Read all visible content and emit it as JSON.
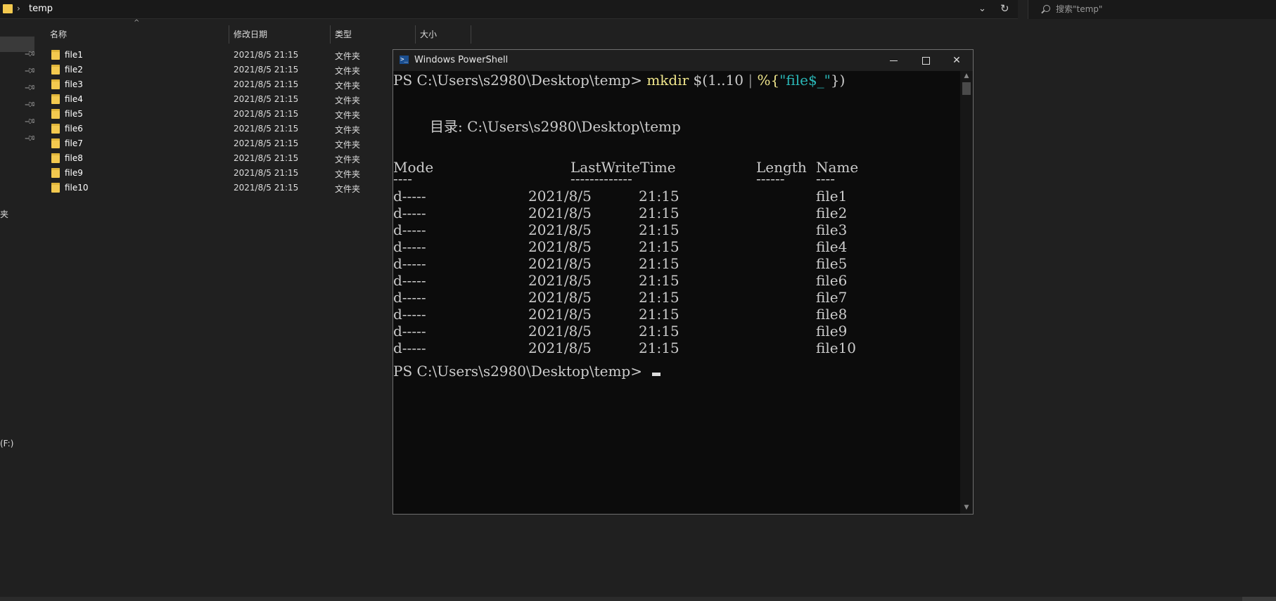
{
  "explorer": {
    "address_path": "temp",
    "address_sep": "›",
    "address_chevron": "⌄",
    "address_refresh": "↻",
    "search_placeholder": "搜索\"temp\"",
    "nav_fragments": [
      "夹",
      "(F:)"
    ],
    "columns": {
      "name": "名称",
      "date": "修改日期",
      "type": "类型",
      "size": "大小"
    },
    "sort_indicator": "^",
    "files": [
      {
        "name": "file1",
        "date": "2021/8/5 21:15",
        "type": "文件夹"
      },
      {
        "name": "file2",
        "date": "2021/8/5 21:15",
        "type": "文件夹"
      },
      {
        "name": "file3",
        "date": "2021/8/5 21:15",
        "type": "文件夹"
      },
      {
        "name": "file4",
        "date": "2021/8/5 21:15",
        "type": "文件夹"
      },
      {
        "name": "file5",
        "date": "2021/8/5 21:15",
        "type": "文件夹"
      },
      {
        "name": "file6",
        "date": "2021/8/5 21:15",
        "type": "文件夹"
      },
      {
        "name": "file7",
        "date": "2021/8/5 21:15",
        "type": "文件夹"
      },
      {
        "name": "file8",
        "date": "2021/8/5 21:15",
        "type": "文件夹"
      },
      {
        "name": "file9",
        "date": "2021/8/5 21:15",
        "type": "文件夹"
      },
      {
        "name": "file10",
        "date": "2021/8/5 21:15",
        "type": "文件夹"
      }
    ]
  },
  "powershell": {
    "title": "Windows PowerShell",
    "icon_glyph": ">_",
    "close_glyph": "✕",
    "prompt": "PS C:\\Users\\s2980\\Desktop\\temp>",
    "command_parts": {
      "cmd": "mkdir",
      "arg": "$(1..10",
      "pipe": "|",
      "foreach": "%{",
      "string": "\"file$_\"",
      "close": "})"
    },
    "directory_line": "目录: C:\\Users\\s2980\\Desktop\\temp",
    "headers": {
      "mode": "Mode",
      "time": "LastWriteTime",
      "length": "Length",
      "name": "Name"
    },
    "underlines": {
      "mode": "----",
      "time": "-------------",
      "length": "------",
      "name": "----"
    },
    "rows": [
      {
        "mode": "d-----",
        "date": "2021/8/5",
        "time": "21:15",
        "name": "file1"
      },
      {
        "mode": "d-----",
        "date": "2021/8/5",
        "time": "21:15",
        "name": "file2"
      },
      {
        "mode": "d-----",
        "date": "2021/8/5",
        "time": "21:15",
        "name": "file3"
      },
      {
        "mode": "d-----",
        "date": "2021/8/5",
        "time": "21:15",
        "name": "file4"
      },
      {
        "mode": "d-----",
        "date": "2021/8/5",
        "time": "21:15",
        "name": "file5"
      },
      {
        "mode": "d-----",
        "date": "2021/8/5",
        "time": "21:15",
        "name": "file6"
      },
      {
        "mode": "d-----",
        "date": "2021/8/5",
        "time": "21:15",
        "name": "file7"
      },
      {
        "mode": "d-----",
        "date": "2021/8/5",
        "time": "21:15",
        "name": "file8"
      },
      {
        "mode": "d-----",
        "date": "2021/8/5",
        "time": "21:15",
        "name": "file9"
      },
      {
        "mode": "d-----",
        "date": "2021/8/5",
        "time": "21:15",
        "name": "file10"
      }
    ],
    "scroll_up_glyph": "▲",
    "scroll_down_glyph": "▼"
  },
  "colors": {
    "explorer_bg": "#202020",
    "folder_yellow": "#f3c94f",
    "console_bg": "#0c0c0c",
    "console_text": "#cccccc",
    "command_yellow": "#f0e68c",
    "string_cyan": "#2ab7b7"
  }
}
